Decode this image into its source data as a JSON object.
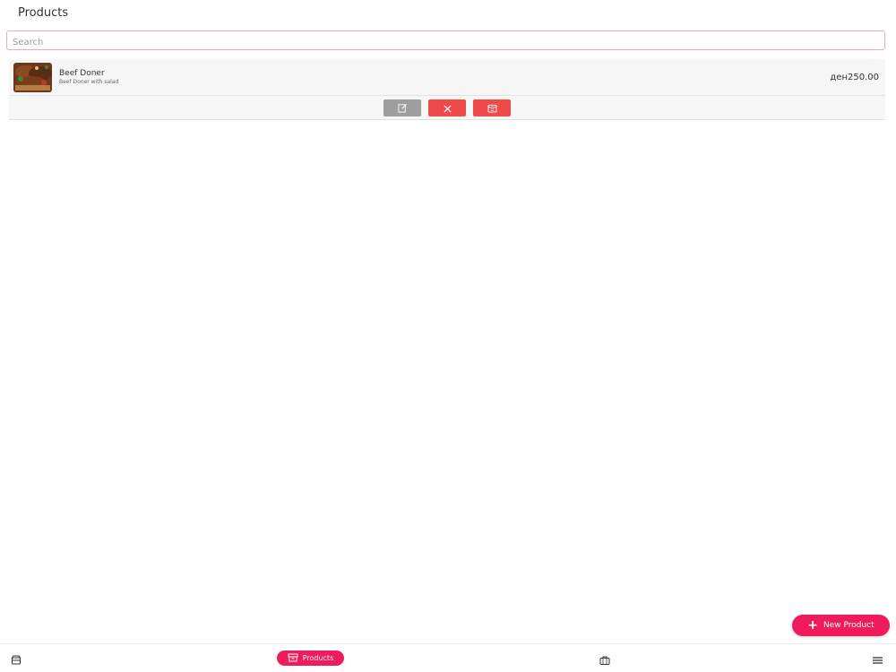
{
  "header": {
    "title": "Products"
  },
  "search": {
    "placeholder": "Search",
    "value": ""
  },
  "products": [
    {
      "name": "Beef Doner",
      "description": "Beef Doner with salad",
      "price": "ден250.00"
    }
  ],
  "fab": {
    "label": "New Product"
  },
  "bottom_nav": {
    "items": [
      {
        "icon": "store-icon",
        "label": ""
      },
      {
        "icon": "products-icon",
        "label": "Products",
        "active": true
      },
      {
        "icon": "briefcase-icon",
        "label": ""
      },
      {
        "icon": "menu-icon",
        "label": ""
      }
    ]
  },
  "colors": {
    "accent": "#ef1b5d",
    "danger": "#ef4a4a",
    "neutral_button": "#9e9e9e",
    "search_border": "#f5a3c2"
  }
}
